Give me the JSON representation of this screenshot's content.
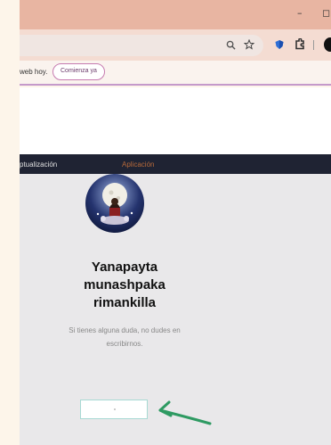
{
  "browser": {
    "window_controls": {
      "minimize": "–",
      "restore": "◻"
    }
  },
  "promo_bar": {
    "text": "web hoy.",
    "cta_label": "Comienza ya"
  },
  "nav": {
    "items": [
      {
        "label": "ptualización"
      },
      {
        "label": "Aplicación"
      }
    ],
    "active_color": "#b76a3a"
  },
  "profile": {
    "title_lines": [
      "Yanapayta",
      "munashpaka",
      "rimankilla"
    ],
    "subtitle_lines": [
      "Si tienes alguna duda, no dudes en",
      "escribirnos."
    ]
  },
  "annotation": {
    "arrow_color": "#2e9a62"
  },
  "icons": {
    "zoom": "search-icon",
    "bookmark": "star-icon",
    "extension": "puzzle-icon"
  }
}
